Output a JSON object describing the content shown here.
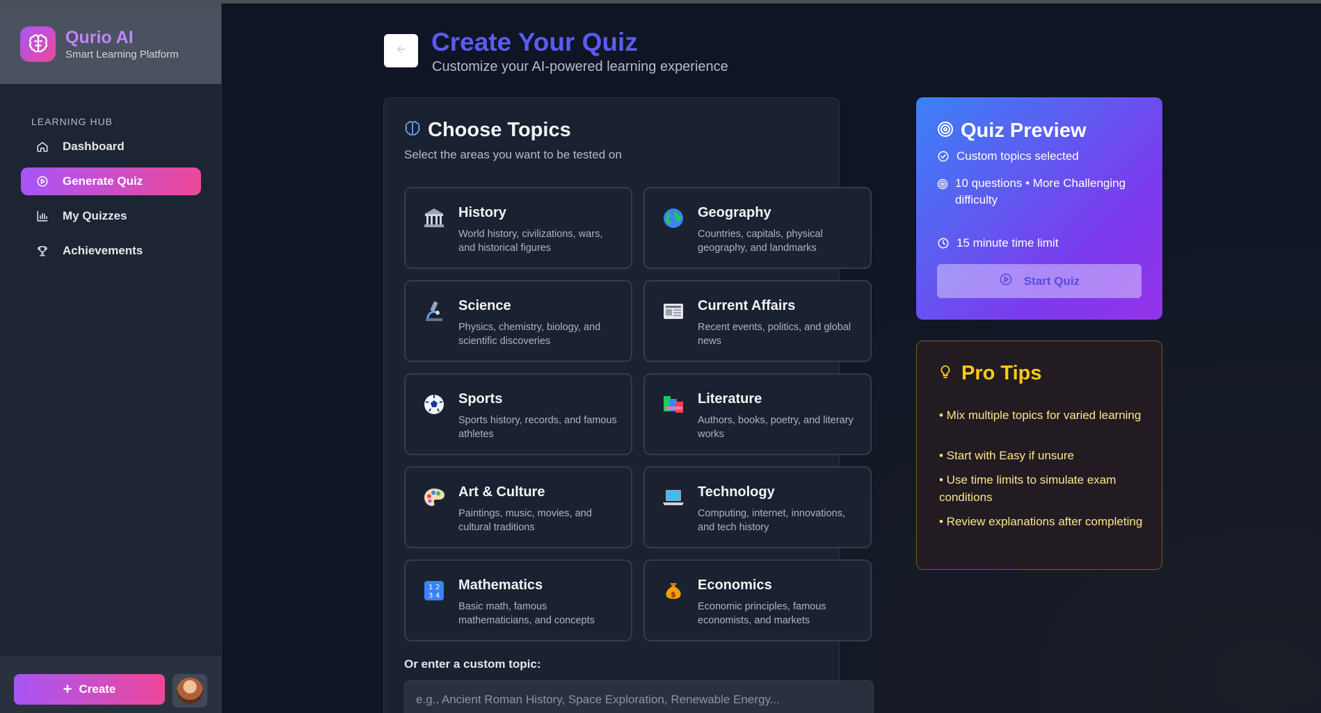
{
  "brand": {
    "name": "Qurio AI",
    "subtitle": "Smart Learning Platform"
  },
  "sidebar": {
    "section_label": "LEARNING HUB",
    "items": [
      {
        "label": "Dashboard",
        "icon": "home-icon",
        "active": false
      },
      {
        "label": "Generate Quiz",
        "icon": "play-circle-icon",
        "active": true
      },
      {
        "label": "My Quizzes",
        "icon": "bar-chart-icon",
        "active": false
      },
      {
        "label": "Achievements",
        "icon": "trophy-icon",
        "active": false
      }
    ],
    "create_label": "Create"
  },
  "header": {
    "title": "Create Your Quiz",
    "subtitle": "Customize your AI-powered learning experience"
  },
  "topics": {
    "title": "Choose Topics",
    "subtitle": "Select the areas you want to be tested on",
    "items": [
      {
        "title": "History",
        "desc": "World history, civilizations, wars, and historical figures",
        "icon": "classical-building-icon"
      },
      {
        "title": "Geography",
        "desc": "Countries, capitals, physical geography, and landmarks",
        "icon": "globe-icon"
      },
      {
        "title": "Science",
        "desc": "Physics, chemistry, biology, and scientific discoveries",
        "icon": "microscope-icon"
      },
      {
        "title": "Current Affairs",
        "desc": "Recent events, politics, and global news",
        "icon": "newspaper-icon"
      },
      {
        "title": "Sports",
        "desc": "Sports history, records, and famous athletes",
        "icon": "soccer-ball-icon"
      },
      {
        "title": "Literature",
        "desc": "Authors, books, poetry, and literary works",
        "icon": "books-icon"
      },
      {
        "title": "Art & Culture",
        "desc": "Paintings, music, movies, and cultural traditions",
        "icon": "palette-icon"
      },
      {
        "title": "Technology",
        "desc": "Computing, internet, innovations, and tech history",
        "icon": "laptop-icon"
      },
      {
        "title": "Mathematics",
        "desc": "Basic math, famous mathematicians, and concepts",
        "icon": "numbers-icon"
      },
      {
        "title": "Economics",
        "desc": "Economic principles, famous economists, and markets",
        "icon": "money-bag-icon"
      }
    ],
    "custom_label": "Or enter a custom topic:",
    "custom_placeholder": "e.g., Ancient Roman History, Space Exploration, Renewable Energy..."
  },
  "preview": {
    "title": "Quiz Preview",
    "rows": [
      {
        "text": "Custom topics selected",
        "icon": "check-circle-icon"
      },
      {
        "text": "10 questions • More Challenging difficulty",
        "icon": "target-icon"
      },
      {
        "text": "15 minute time limit",
        "icon": "clock-icon"
      }
    ],
    "start_label": "Start Quiz"
  },
  "tips": {
    "title": "Pro Tips",
    "items": [
      "• Mix multiple topics for varied learning",
      "• Start with Easy if unsure",
      "• Use time limits to simulate exam conditions",
      "• Review explanations after completing"
    ]
  },
  "colors": {
    "accent_gradient_start": "#a855f7",
    "accent_gradient_end": "#ec4899",
    "title_blue": "#5b5cf0",
    "tips_yellow": "#facc15",
    "background": "#0f1524"
  }
}
